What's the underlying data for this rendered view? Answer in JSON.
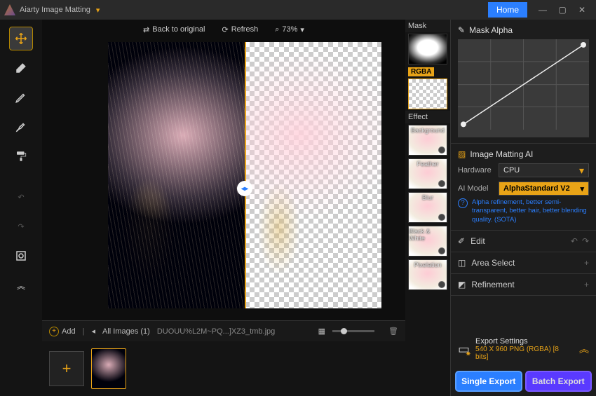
{
  "titlebar": {
    "app": "Aiarty Image Matting",
    "home": "Home"
  },
  "toolbar": {
    "back": "Back to original",
    "refresh": "Refresh",
    "zoom": "73%"
  },
  "mask": {
    "label": "Mask",
    "rgba": "RGBA",
    "effect": "Effect",
    "effects": [
      "Background",
      "Feather",
      "Blur",
      "Black & White",
      "Pixelation"
    ]
  },
  "right": {
    "maskalpha": "Mask Alpha",
    "matting": "Image Matting AI",
    "hw_lab": "Hardware",
    "hw_val": "CPU",
    "model_lab": "AI Model",
    "model_val": "AlphaStandard  V2",
    "hint": "Alpha refinement, better semi-transparent, better hair, better blending quality. (SOTA)",
    "edit": "Edit",
    "area": "Area Select",
    "refine": "Refinement"
  },
  "bottom": {
    "add": "Add",
    "nav": "All Images (1)",
    "file": "DUOUU%L2M~PQ...]XZ3_tmb.jpg"
  },
  "export": {
    "title": "Export Settings",
    "spec": "540 X 960  PNG (RGBA) [8 bits]",
    "single": "Single Export",
    "batch": "Batch Export"
  }
}
